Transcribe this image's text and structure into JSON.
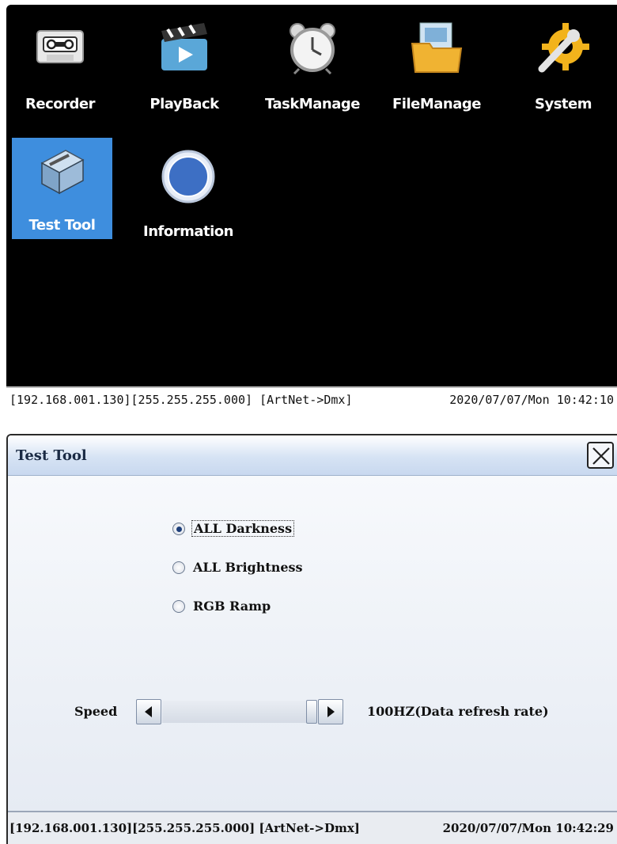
{
  "main_menu": {
    "apps": [
      {
        "label": "Recorder",
        "icon": "cassette-tape-icon"
      },
      {
        "label": "PlayBack",
        "icon": "clapperboard-icon"
      },
      {
        "label": "TaskManage",
        "icon": "alarm-clock-icon"
      },
      {
        "label": "FileManage",
        "icon": "folder-icon"
      },
      {
        "label": "System",
        "icon": "gear-wrench-icon"
      },
      {
        "label": "Test Tool",
        "icon": "toolbox-icon",
        "selected": true
      },
      {
        "label": "Information",
        "icon": "info-icon"
      }
    ],
    "status": {
      "network": "[192.168.001.130][255.255.255.000] [ArtNet->Dmx]",
      "datetime": "2020/07/07/Mon  10:42:10"
    }
  },
  "test_tool": {
    "title": "Test Tool",
    "options": [
      {
        "label": "ALL Darkness",
        "checked": true
      },
      {
        "label": "ALL Brightness",
        "checked": false
      },
      {
        "label": "RGB Ramp",
        "checked": false
      }
    ],
    "speed": {
      "label": "Speed",
      "rate_text": "100HZ(Data refresh rate)",
      "level": 1.0
    },
    "status": {
      "network": "[192.168.001.130][255.255.255.000] [ArtNet->Dmx]",
      "datetime": "2020/07/07/Mon  10:42:29"
    }
  },
  "colors": {
    "selected_tile": "#3e8ede",
    "dialog_title_gradient": "#c8d8ef"
  }
}
